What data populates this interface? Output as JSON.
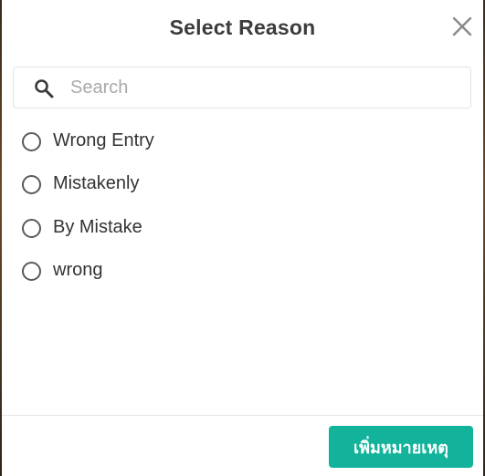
{
  "modal": {
    "title": "Select Reason",
    "close_icon": "close-icon"
  },
  "search": {
    "placeholder": "Search",
    "value": "",
    "icon": "search-icon"
  },
  "reasons": [
    {
      "label": "Wrong Entry",
      "selected": false
    },
    {
      "label": "Mistakenly",
      "selected": false
    },
    {
      "label": "By Mistake",
      "selected": false
    },
    {
      "label": "wrong",
      "selected": false
    }
  ],
  "footer": {
    "add_reason_label": "เพิ่มหมายเหตุ"
  },
  "colors": {
    "accent": "#12b39a",
    "title_text": "#3c3c3c",
    "radio_border": "#5a5a5a"
  }
}
